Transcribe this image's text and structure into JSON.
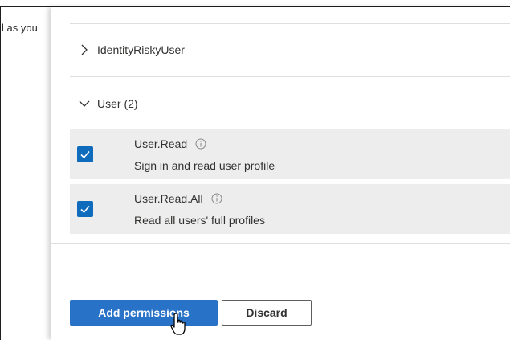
{
  "background": {
    "partial_text": "l as you"
  },
  "groups": [
    {
      "label": "IdentityRiskyUser",
      "expanded": false
    },
    {
      "label": "User (2)",
      "expanded": true
    }
  ],
  "permissions": [
    {
      "name": "User.Read",
      "description": "Sign in and read user profile",
      "checked": true
    },
    {
      "name": "User.Read.All",
      "description": "Read all users' full profiles",
      "checked": true
    }
  ],
  "buttons": {
    "add_label": "Add permissions",
    "discard_label": "Discard"
  },
  "colors": {
    "accent": "#2872c8",
    "checkbox": "#0f6cbd",
    "row_bg": "#ededed"
  },
  "icons": {
    "collapsed": "chevron-right-icon",
    "expanded": "chevron-down-icon",
    "info": "info-icon",
    "cursor": "hand-pointer-cursor-icon"
  }
}
